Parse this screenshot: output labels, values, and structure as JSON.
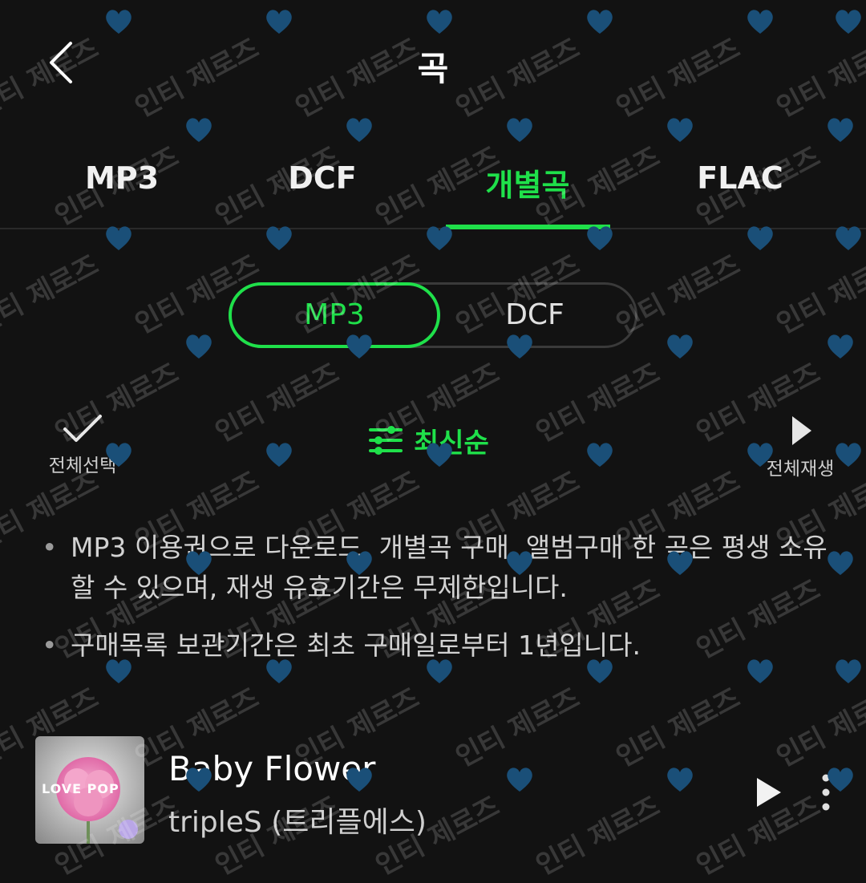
{
  "header": {
    "title": "곡"
  },
  "tabs": [
    {
      "label": "MP3",
      "active": false
    },
    {
      "label": "DCF",
      "active": false
    },
    {
      "label": "개별곡",
      "active": true
    },
    {
      "label": "FLAC",
      "active": false
    }
  ],
  "format_toggle": {
    "options": [
      "MP3",
      "DCF"
    ],
    "selected": "MP3"
  },
  "actions": {
    "select_all": "전체선택",
    "sort": "최신순",
    "play_all": "전체재생"
  },
  "notices": [
    "MP3 이용권으로 다운로드, 개별곡 구매, 앨범구매 한 곡은 평생 소유할 수 있으며, 재생 유효기간은 무제한입니다.",
    "구매목록 보관기간은 최초 구매일로부터 1년입니다."
  ],
  "songs": [
    {
      "title": "Baby Flower",
      "artist": "tripleS (트리플에스)",
      "cover_text": "LOVE POP"
    }
  ],
  "watermark": {
    "text": "인티 제로즈",
    "heart_color": "#1a4f78"
  },
  "colors": {
    "accent": "#1fe04a",
    "background": "#121212"
  }
}
